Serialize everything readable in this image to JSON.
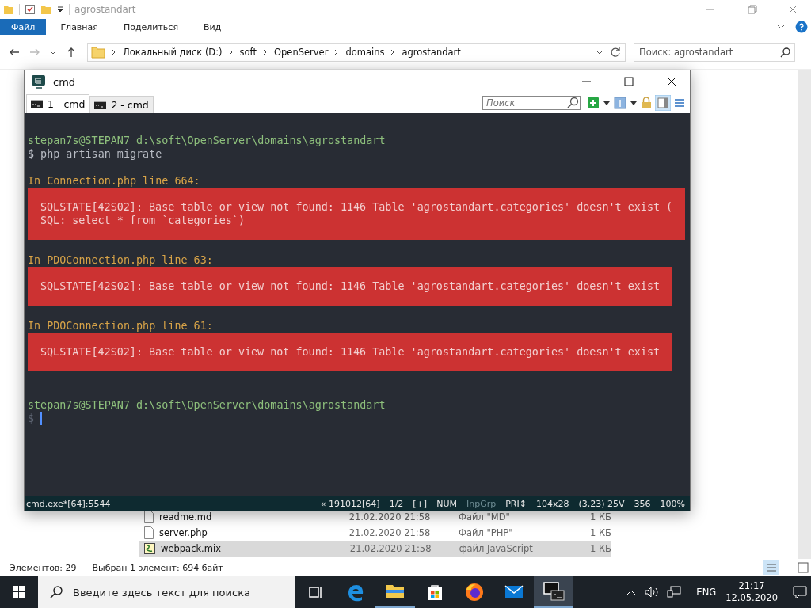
{
  "explorer": {
    "title": "agrostandart",
    "ribbon_tabs": [
      {
        "label": "Файл",
        "selected": true
      },
      {
        "label": "Главная",
        "selected": false
      },
      {
        "label": "Поделиться",
        "selected": false
      },
      {
        "label": "Вид",
        "selected": false
      }
    ],
    "breadcrumbs": [
      "Локальный диск (D:)",
      "soft",
      "OpenServer",
      "domains",
      "agrostandart"
    ],
    "search": {
      "placeholder": "Поиск: agrostandart"
    },
    "files": [
      {
        "name": "readme.md",
        "date": "21.02.2020 21:58",
        "type": "Файл \"MD\"",
        "size": "1 КБ",
        "kind": "file",
        "selected": false
      },
      {
        "name": "server.php",
        "date": "21.02.2020 21:58",
        "type": "Файл \"PHP\"",
        "size": "1 КБ",
        "kind": "file",
        "selected": false
      },
      {
        "name": "webpack.mix",
        "date": "21.02.2020 21:58",
        "type": "файл JavaScript",
        "size": "1 КБ",
        "kind": "script",
        "selected": true
      }
    ],
    "status": [
      "Элементов: 29",
      "Выбран 1 элемент: 694 байт"
    ]
  },
  "cmd": {
    "title": "cmd",
    "tabs": [
      {
        "label": "1 - cmd",
        "selected": true
      },
      {
        "label": "2 - cmd",
        "selected": false
      }
    ],
    "search": {
      "placeholder": "Поиск"
    },
    "lines": [
      {
        "kind": "blank"
      },
      {
        "kind": "prompt",
        "text": "stepan7s@STEPAN7 d:\\soft\\OpenServer\\domains\\agrostandart"
      },
      {
        "kind": "command",
        "text": "$ php artisan migrate"
      },
      {
        "kind": "blank"
      },
      {
        "kind": "heading",
        "text": "In Connection.php line 664:"
      },
      {
        "kind": "error",
        "lines": [
          "SQLSTATE[42S02]: Base table or view not found: 1146 Table 'agrostandart.categories' doesn't exist (",
          "SQL: select * from `categories`)"
        ]
      },
      {
        "kind": "blank"
      },
      {
        "kind": "heading",
        "text": "In PDOConnection.php line 63:"
      },
      {
        "kind": "error",
        "lines": [
          "SQLSTATE[42S02]: Base table or view not found: 1146 Table 'agrostandart.categories' doesn't exist"
        ]
      },
      {
        "kind": "blank"
      },
      {
        "kind": "heading",
        "text": "In PDOConnection.php line 61:"
      },
      {
        "kind": "error",
        "lines": [
          "SQLSTATE[42S02]: Base table or view not found: 1146 Table 'agrostandart.categories' doesn't exist"
        ]
      },
      {
        "kind": "blank"
      },
      {
        "kind": "blank"
      },
      {
        "kind": "prompt",
        "text": "stepan7s@STEPAN7 d:\\soft\\OpenServer\\domains\\agrostandart"
      },
      {
        "kind": "input",
        "text": "$"
      }
    ],
    "status_left": "cmd.exe*[64]:5544",
    "status_items": [
      {
        "text": "« 191012[64]",
        "disabled": false
      },
      {
        "text": "1/2",
        "disabled": false
      },
      {
        "text": "[+]",
        "disabled": false
      },
      {
        "text": "NUM",
        "disabled": false
      },
      {
        "text": "InpGrp",
        "disabled": true
      },
      {
        "text": "PRI↕",
        "disabled": false
      },
      {
        "text": "104x28",
        "disabled": false
      },
      {
        "text": "(3,23) 25V",
        "disabled": false
      },
      {
        "text": "356",
        "disabled": false
      },
      {
        "text": "100%",
        "disabled": false
      }
    ]
  },
  "taskbar": {
    "search": {
      "placeholder": "Введите здесь текст для поиска"
    },
    "apps": [
      {
        "kind": "taskview",
        "running": false,
        "selected": false
      },
      {
        "kind": "edge",
        "running": false,
        "selected": false
      },
      {
        "kind": "folder",
        "running": true,
        "selected": false
      },
      {
        "kind": "store",
        "running": false,
        "selected": false
      },
      {
        "kind": "firefox",
        "running": false,
        "selected": false
      },
      {
        "kind": "mail",
        "running": false,
        "selected": false
      },
      {
        "kind": "console",
        "running": true,
        "selected": true
      }
    ],
    "language": "ENG",
    "time": "21:17",
    "date": "12.05.2020"
  }
}
